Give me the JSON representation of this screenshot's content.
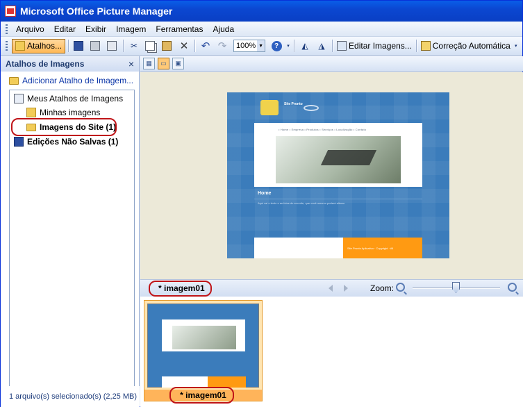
{
  "window": {
    "title": "Microsoft Office Picture Manager"
  },
  "menu": {
    "items": [
      "Arquivo",
      "Editar",
      "Exibir",
      "Imagem",
      "Ferramentas",
      "Ajuda"
    ]
  },
  "toolbar": {
    "shortcuts_label": "Atalhos...",
    "zoom_value": "100%",
    "edit_images_label": "Editar Imagens...",
    "auto_correct_label": "Correção Automática"
  },
  "sidebar": {
    "title": "Atalhos de Imagens",
    "close_glyph": "×",
    "add_shortcut_label": "Adicionar Atalho de Imagem...",
    "tree": {
      "root": "Meus Atalhos de Imagens",
      "child1": "Minhas imagens",
      "child2": "Imagens do Site (1)",
      "unsaved": "Edições Não Salvas (1)"
    },
    "status": "1 arquivo(s) selecionado(s) (2,25 MB)"
  },
  "preview": {
    "site_brand": "Site Pronto",
    "site_nav": "• Home   • Empresa   • Produtos   • Serviços   • Localização   • Contato",
    "site_home": "Home",
    "site_desc": "Aqui vai o texto e as fotos do seu site, que você mesmo poderá alterar.",
    "site_footer": "Site Pronto Aplicativo · Copyright · All"
  },
  "namebar": {
    "filename": "* imagem01",
    "zoom_label": "Zoom:"
  },
  "filmstrip": {
    "items": [
      {
        "label": "* imagem01"
      }
    ]
  },
  "colors": {
    "title_blue": "#0a47d1",
    "highlight_red": "#c01418",
    "selected_orange": "#ffb45a"
  }
}
